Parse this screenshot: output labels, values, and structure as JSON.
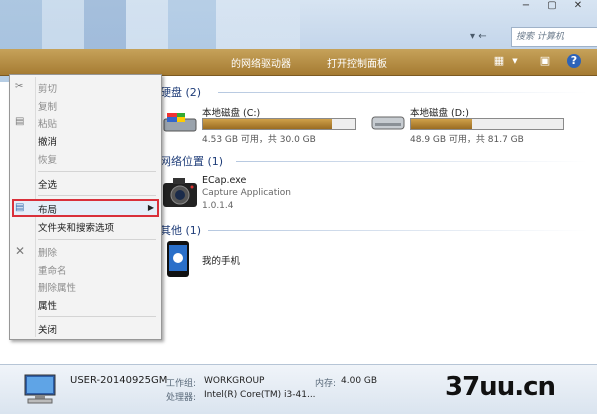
{
  "window": {
    "controls": [
      "−",
      "▢",
      "✕"
    ]
  },
  "nav": {
    "arrows": "▾ ←"
  },
  "search": {
    "placeholder": "搜索 计算机"
  },
  "toolbar": {
    "item1": "的网络驱动器",
    "item2": "打开控制面板",
    "icons": [
      "view-icon",
      "preview-pane-icon",
      "help-icon"
    ]
  },
  "sections": {
    "drives_title": "硬盘 (2)",
    "network_title": "网络位置 (1)",
    "other_title": "其他 (1)"
  },
  "drives": [
    {
      "name": "本地磁盘 (C:)",
      "info": "4.53 GB 可用，共 30.0 GB",
      "used_fraction": 0.85
    },
    {
      "name": "本地磁盘 (D:)",
      "info": "48.9 GB 可用，共 81.7 GB",
      "used_fraction": 0.4
    }
  ],
  "network_item": {
    "line1": "ECap.exe",
    "line2": "Capture Application",
    "line3": "1.0.1.4"
  },
  "other_item": {
    "label": "我的手机"
  },
  "menu": {
    "cut": "剪切",
    "copy": "复制",
    "paste": "粘贴",
    "undo": "撤消",
    "redo": "恢复",
    "select_all": "全选",
    "layout": "布局",
    "folder_options": "文件夹和搜索选项",
    "delete": "删除",
    "rename": "重命名",
    "remove_properties": "删除属性",
    "properties": "属性",
    "close": "关闭"
  },
  "details": {
    "computer_name": "USER-20140925GM",
    "workgroup_label": "工作组:",
    "workgroup_value": "WORKGROUP",
    "memory_label": "内存:",
    "memory_value": "4.00 GB",
    "cpu_label": "处理器:",
    "cpu_value": "Intel(R) Core(TM) i3-41..."
  },
  "watermark": "37uu.cn",
  "colors": {
    "toolbar": "#b08a42",
    "highlight_border": "#d9303a",
    "section_title": "#1e3c78",
    "drive_fill": "#b8863a"
  }
}
